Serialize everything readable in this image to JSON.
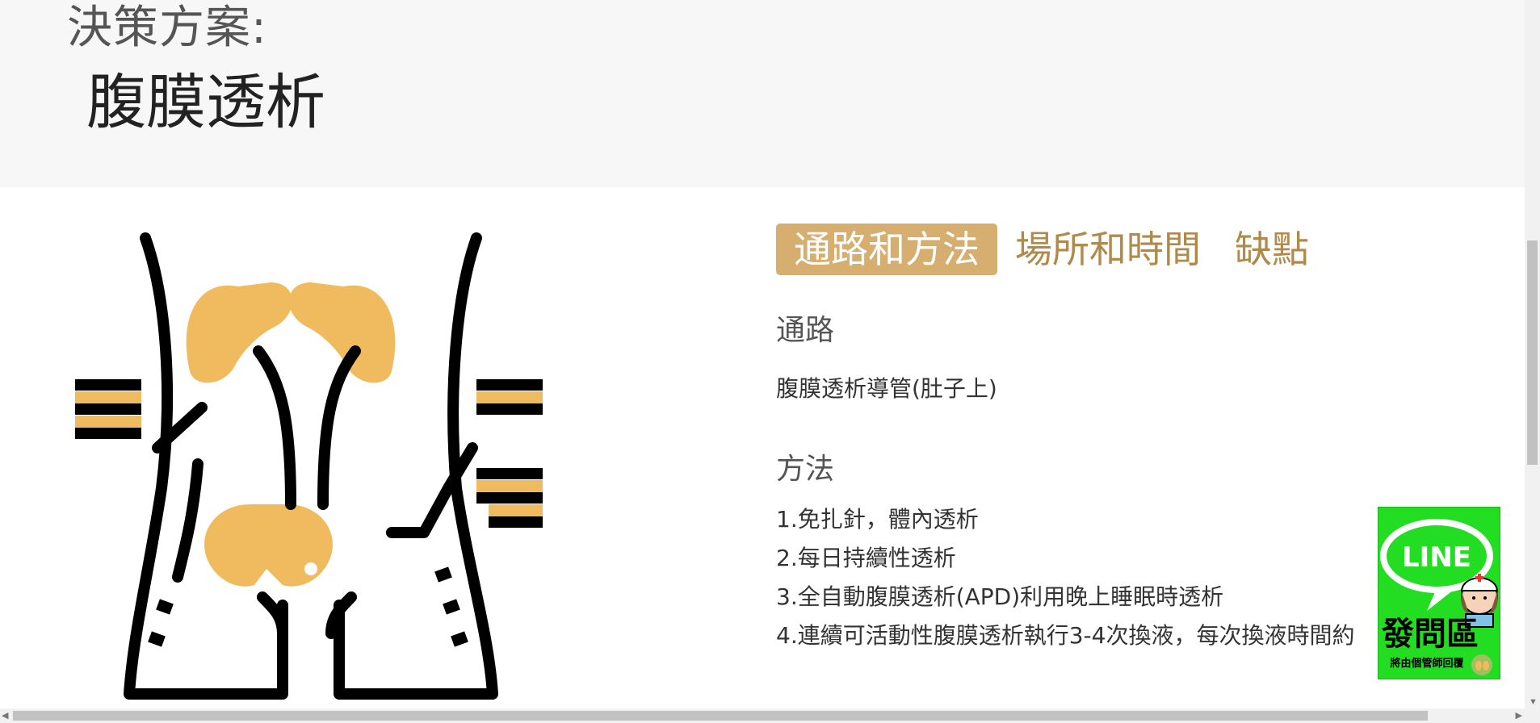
{
  "header": {
    "label": "決策方案:",
    "title": "腹膜透析"
  },
  "tabs": [
    {
      "label": "通路和方法",
      "active": true
    },
    {
      "label": "場所和時間",
      "active": false
    },
    {
      "label": "缺點",
      "active": false
    }
  ],
  "route": {
    "heading": "通路",
    "text": "腹膜透析導管(肚子上)"
  },
  "method": {
    "heading": "方法",
    "items": [
      "1.免扎針，體內透析",
      "2.每日持續性透析",
      "3.全自動腹膜透析(APD)利用晚上睡眠時透析",
      "4.連續可活動性腹膜透析執行3-4次換液，每次換液時間約"
    ]
  },
  "line_badge": {
    "logo_text": "LINE",
    "title": "發問區",
    "subtitle": "將由個管師回覆"
  },
  "colors": {
    "accent": "#d6ae6f",
    "tab_inactive": "#b08a4a",
    "illustration_fill": "#f0bb5e",
    "line_green": "#22dd22"
  },
  "icons": {
    "illustration": "peritoneal-dialysis-body-icon",
    "nurse": "nurse-avatar-icon"
  }
}
